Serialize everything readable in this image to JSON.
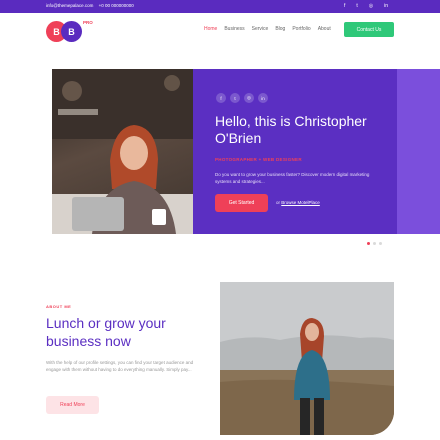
{
  "topbar": {
    "email": "info@themepalace.com",
    "phone": "+0 00 000000000",
    "socials": [
      {
        "icon": "facebook-icon",
        "glyph": "f"
      },
      {
        "icon": "twitter-icon",
        "glyph": "t"
      },
      {
        "icon": "instagram-icon",
        "glyph": "◎"
      },
      {
        "icon": "linkedin-icon",
        "glyph": "in"
      }
    ]
  },
  "header": {
    "logo": {
      "letter1": "B",
      "letter2": "B",
      "badge": "PRO"
    },
    "nav": [
      "Home",
      "Business",
      "Service",
      "Blog",
      "Portfolio",
      "About"
    ],
    "active_nav": "Home",
    "contact_button": "Contact Us"
  },
  "hero": {
    "socials": [
      "f",
      "t",
      "◎",
      "in"
    ],
    "title": "Hello, this is Christopher O'Brien",
    "role": "PHOTOGRAPHER + WEB DESIGNER",
    "description": "Do you want to grow your business faster? Discover modern digital marketing systems and strategies...",
    "primary_button": "Get Started",
    "secondary_prefix": "or",
    "secondary_link": "Browse MotelPlace",
    "slides_total": 3,
    "slide_active": 1
  },
  "about": {
    "kicker": "ABOUT ME",
    "title": "Lunch or grow your business now",
    "text": "With the help of our profile settings, you can find your target audience and engage with them without having to do everything manually. Simply pay...",
    "button": "Read More"
  },
  "colors": {
    "brand_purple": "#5b2fc2",
    "accent_red": "#ef4058",
    "contact_green": "#2fc879"
  }
}
